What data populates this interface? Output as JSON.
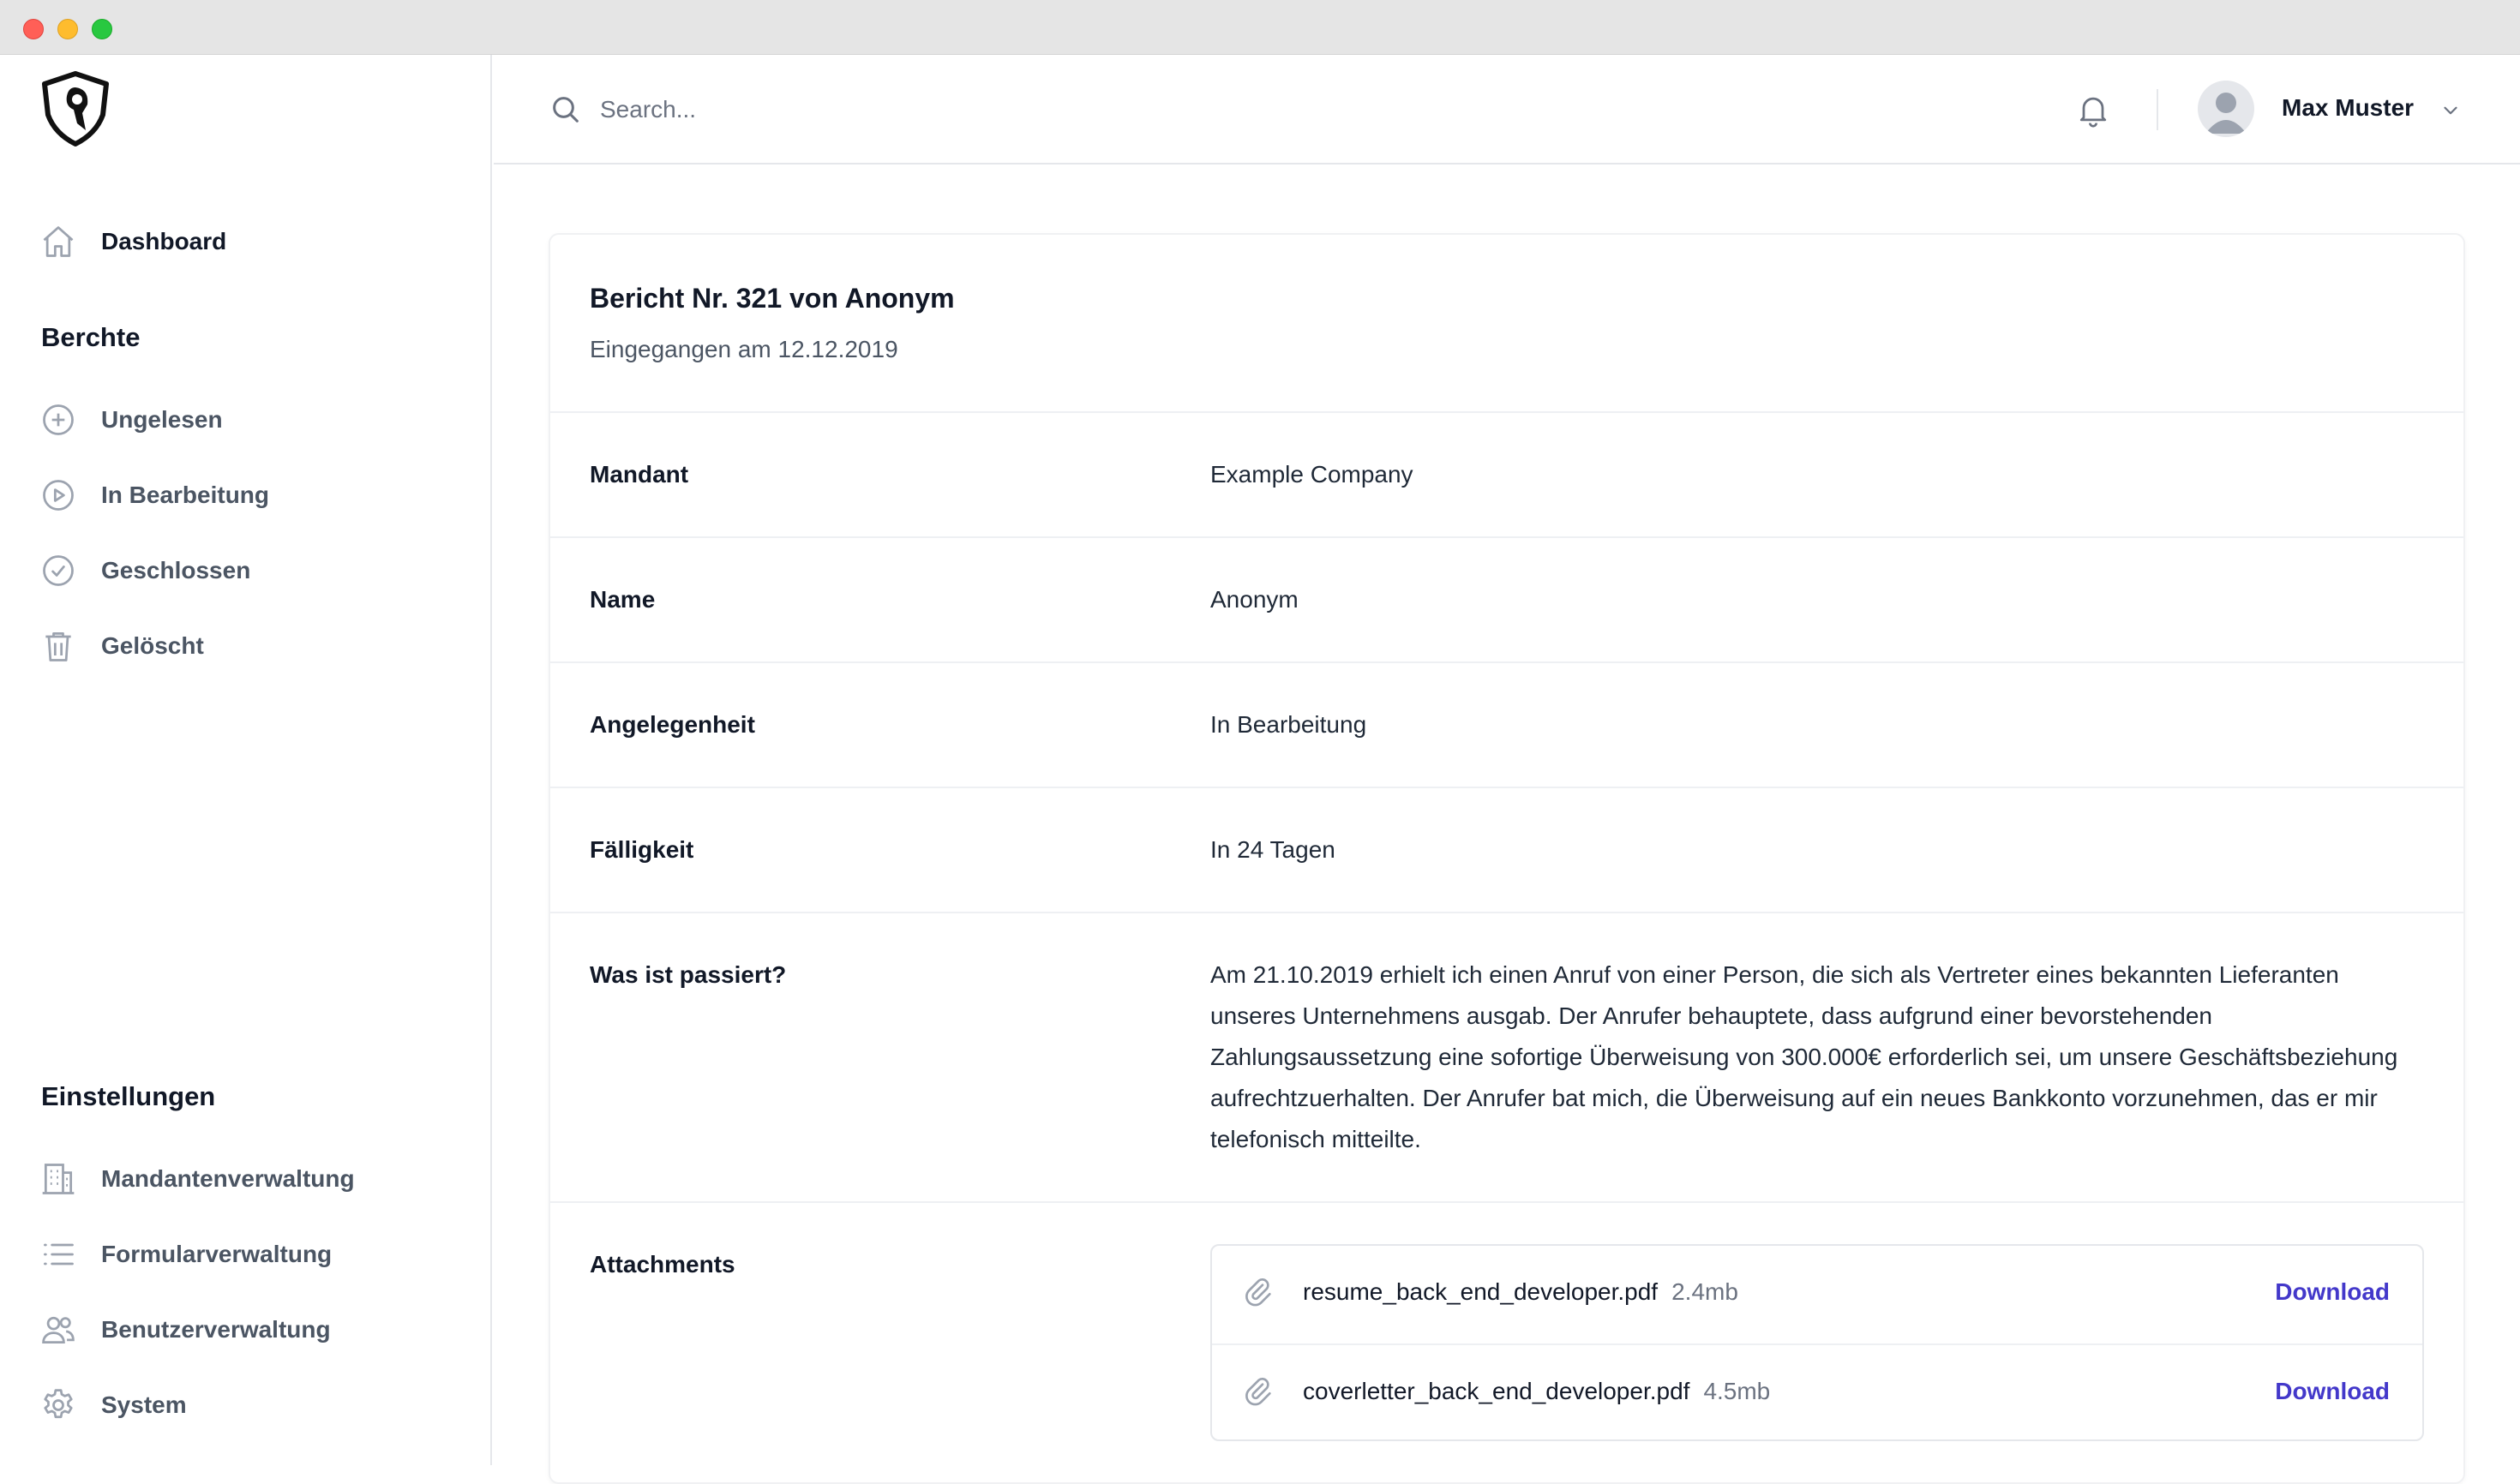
{
  "topbar": {
    "search_placeholder": "Search...",
    "user_name": "Max Muster"
  },
  "sidebar": {
    "dashboard_label": "Dashboard",
    "reports_heading": "Berchte",
    "reports": [
      {
        "label": "Ungelesen",
        "icon": "plus-circle-icon"
      },
      {
        "label": "In Bearbeitung",
        "icon": "play-circle-icon"
      },
      {
        "label": "Geschlossen",
        "icon": "check-circle-icon"
      },
      {
        "label": "Gelöscht",
        "icon": "trash-icon"
      }
    ],
    "settings_heading": "Einstellungen",
    "settings": [
      {
        "label": "Mandantenverwaltung",
        "icon": "building-icon"
      },
      {
        "label": "Formularverwaltung",
        "icon": "list-icon"
      },
      {
        "label": "Benutzerverwaltung",
        "icon": "users-icon"
      },
      {
        "label": "System",
        "icon": "gear-icon"
      }
    ]
  },
  "report": {
    "title": "Bericht Nr. 321 von Anonym",
    "subtitle": "Eingegangen am 12.12.2019",
    "fields": [
      {
        "label": "Mandant",
        "value": "Example Company"
      },
      {
        "label": "Name",
        "value": "Anonym"
      },
      {
        "label": "Angelegenheit",
        "value": "In Bearbeitung"
      },
      {
        "label": "Fälligkeit",
        "value": "In 24 Tagen"
      }
    ],
    "description_label": "Was ist passiert?",
    "description": "Am 21.10.2019 erhielt ich einen Anruf von einer Person, die sich als Vertreter eines bekannten Lieferanten unseres Unternehmens ausgab. Der Anrufer behauptete, dass aufgrund einer bevorstehenden Zahlungsaussetzung eine sofortige Überweisung von 300.000€ erforderlich sei, um unsere Geschäftsbeziehung aufrechtzuerhalten. Der Anrufer bat mich, die Überweisung auf ein neues Bankkonto vorzunehmen, das er mir telefonisch mitteilte.",
    "attachments_label": "Attachments",
    "attachments": [
      {
        "name": "resume_back_end_developer.pdf",
        "size": "2.4mb",
        "action": "Download"
      },
      {
        "name": "coverletter_back_end_developer.pdf",
        "size": "4.5mb",
        "action": "Download"
      }
    ]
  },
  "colors": {
    "accent": "#4338ca",
    "muted_text": "#6b7280",
    "border": "#e5e7eb"
  }
}
